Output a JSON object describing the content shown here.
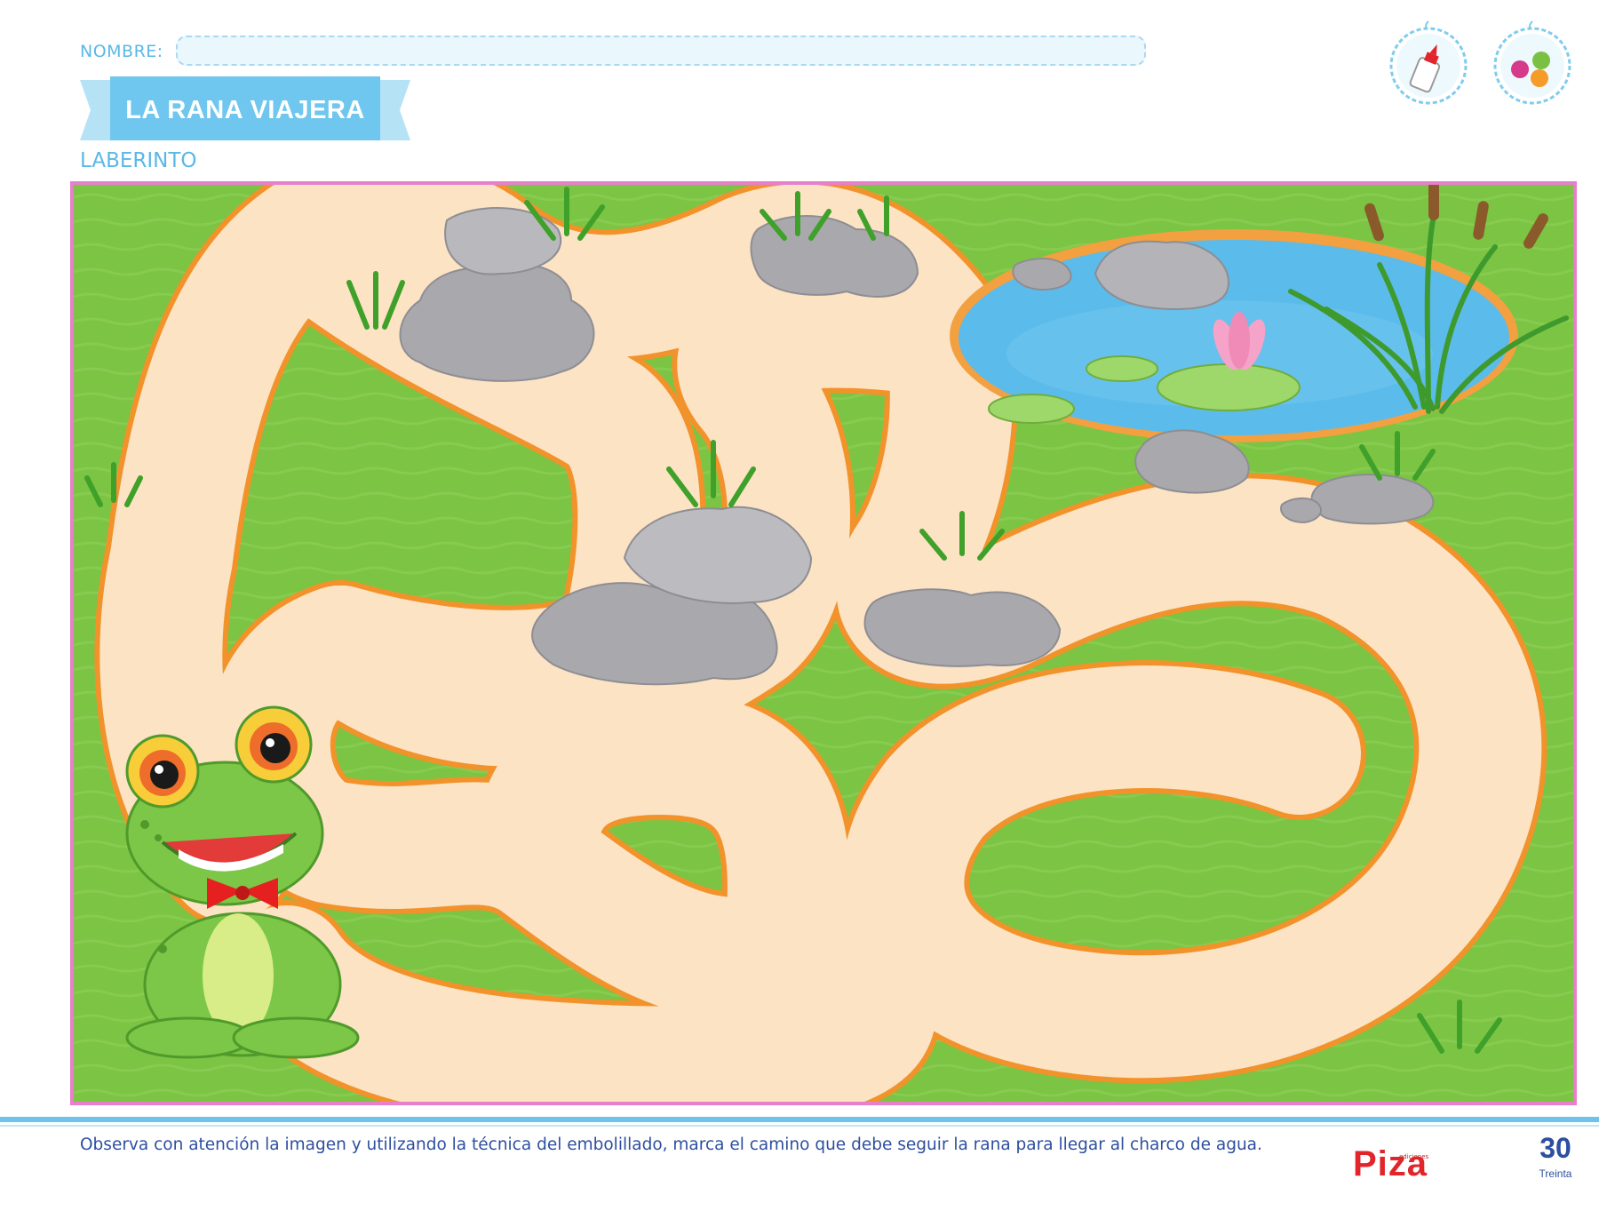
{
  "header": {
    "name_label": "NOMBRE:",
    "name_value": "",
    "title": "LA RANA VIAJERA",
    "subtitle": "LABERINTO"
  },
  "materials": [
    {
      "icon": "glue-bottle-icon"
    },
    {
      "icon": "crepe-paper-balls-icon"
    }
  ],
  "footer": {
    "instructions": "Observa con atención la imagen y utilizando la técnica del embolillado, marca el camino que debe seguir la rana para llegar al charco de agua.",
    "publisher_small": "ediciones",
    "publisher": "Piza",
    "page_number": "30",
    "page_word": "Treinta"
  },
  "colors": {
    "accent_blue": "#5ab8e6",
    "frame_pink": "#e77fcb",
    "grass_green": "#7cc443",
    "path_cream": "#fbe3c4",
    "path_border": "#f2922b",
    "text_navy": "#2d4fa0",
    "logo_red": "#e2252b"
  }
}
